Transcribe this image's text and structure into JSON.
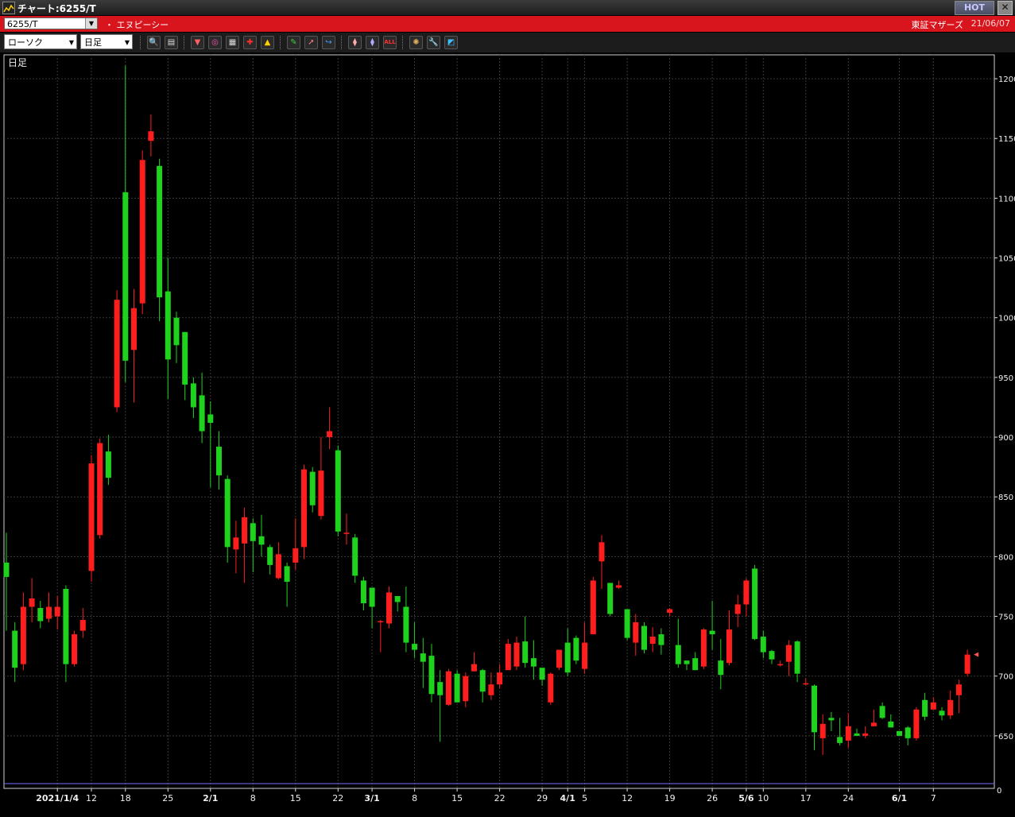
{
  "window": {
    "title": "チャート:6255/T",
    "hot_label": "HOT",
    "close_glyph": "✕"
  },
  "info": {
    "code": "6255/T",
    "company": "・ エヌピーシー",
    "market": "東証マザーズ",
    "date": "21/06/07"
  },
  "toolbar": {
    "chart_type": "ローソク",
    "period": "日足",
    "buttons": [
      {
        "name": "zoom-icon",
        "glyph": "🔍",
        "color": "#3aa0ff"
      },
      {
        "name": "layout-icon",
        "glyph": "▤",
        "color": "#dddddd"
      },
      {
        "name": "insert-icon",
        "glyph": "▼",
        "color": "#ff6060"
      },
      {
        "name": "search-zoom-icon",
        "glyph": "◎",
        "color": "#ff4fb0"
      },
      {
        "name": "table-icon",
        "glyph": "▦",
        "color": "#dddddd"
      },
      {
        "name": "split-icon",
        "glyph": "✚",
        "color": "#ff3030"
      },
      {
        "name": "alert-icon",
        "glyph": "▲",
        "color": "#ffd000"
      },
      {
        "name": "pencil-icon",
        "glyph": "✎",
        "color": "#40d040"
      },
      {
        "name": "pointer-icon",
        "glyph": "➚",
        "color": "#ff8080"
      },
      {
        "name": "redo-icon",
        "glyph": "↪",
        "color": "#40a0ff"
      },
      {
        "name": "candle-left-icon",
        "glyph": "⧫",
        "color": "#ffaaaa"
      },
      {
        "name": "candle-right-icon",
        "glyph": "⧫",
        "color": "#aaaaff"
      },
      {
        "name": "all-icon",
        "glyph": "ALL",
        "color": "#ff3030"
      },
      {
        "name": "settings-icon",
        "glyph": "✺",
        "color": "#e0b060"
      },
      {
        "name": "tool-icon",
        "glyph": "🔧",
        "color": "#ff8040"
      },
      {
        "name": "color-icon",
        "glyph": "◩",
        "color": "#40c0ff"
      }
    ]
  },
  "chart_data": {
    "type": "candlestick",
    "period_label": "日足",
    "y_ticks": [
      650,
      700,
      750,
      800,
      850,
      900,
      950,
      1000,
      1050,
      1100,
      1150,
      1200
    ],
    "y_range": [
      606,
      1220
    ],
    "volume_axis_label": "0",
    "x_labels": [
      {
        "label": "2021/1/4",
        "index": 6,
        "bold": true
      },
      {
        "label": "12",
        "index": 10
      },
      {
        "label": "18",
        "index": 14
      },
      {
        "label": "25",
        "index": 19
      },
      {
        "label": "2/1",
        "index": 24,
        "bold": true
      },
      {
        "label": "8",
        "index": 29
      },
      {
        "label": "15",
        "index": 34
      },
      {
        "label": "22",
        "index": 39
      },
      {
        "label": "3/1",
        "index": 43,
        "bold": true
      },
      {
        "label": "8",
        "index": 48
      },
      {
        "label": "15",
        "index": 53
      },
      {
        "label": "22",
        "index": 58
      },
      {
        "label": "29",
        "index": 63
      },
      {
        "label": "4/1",
        "index": 66,
        "bold": true
      },
      {
        "label": "5",
        "index": 68
      },
      {
        "label": "12",
        "index": 73
      },
      {
        "label": "19",
        "index": 78
      },
      {
        "label": "26",
        "index": 83
      },
      {
        "label": "5/6",
        "index": 87,
        "bold": true
      },
      {
        "label": "10",
        "index": 89
      },
      {
        "label": "17",
        "index": 94
      },
      {
        "label": "24",
        "index": 99
      },
      {
        "label": "6/1",
        "index": 105,
        "bold": true
      },
      {
        "label": "7",
        "index": 109
      }
    ],
    "colors": {
      "up": "#ff1e1e",
      "down": "#1ed21e",
      "grid": "#3a3a3a",
      "axis": "#e0e0e0",
      "text": "#f0f0f0",
      "volume": "#7070ff"
    },
    "candles": [
      [
        795,
        783,
        820,
        738
      ],
      [
        738,
        707,
        745,
        695
      ],
      [
        710,
        758,
        770,
        705
      ],
      [
        758,
        765,
        782,
        745
      ],
      [
        757,
        746,
        763,
        740
      ],
      [
        748,
        758,
        770,
        745
      ],
      [
        750,
        758,
        767,
        739
      ],
      [
        773,
        710,
        776,
        695
      ],
      [
        710,
        735,
        738,
        708
      ],
      [
        738,
        747,
        757,
        732
      ],
      [
        788,
        878,
        885,
        779
      ],
      [
        818,
        895,
        899,
        815
      ],
      [
        888,
        866,
        902,
        860
      ],
      [
        925,
        1015,
        1023,
        921
      ],
      [
        1105,
        964,
        1211,
        946
      ],
      [
        973,
        1008,
        1024,
        929
      ],
      [
        1012,
        1132,
        1140,
        1003
      ],
      [
        1148,
        1156,
        1170,
        1135
      ],
      [
        1127,
        1017,
        1133,
        997
      ],
      [
        1022,
        965,
        1050,
        932
      ],
      [
        1000,
        977,
        1005,
        962
      ],
      [
        988,
        944,
        988,
        931
      ],
      [
        945,
        925,
        950,
        916
      ],
      [
        935,
        905,
        954,
        895
      ],
      [
        919,
        912,
        930,
        858
      ],
      [
        892,
        868,
        905,
        856
      ],
      [
        865,
        808,
        868,
        795
      ],
      [
        806,
        816,
        830,
        786
      ],
      [
        811,
        833,
        841,
        778
      ],
      [
        828,
        813,
        832,
        787
      ],
      [
        817,
        810,
        835,
        800
      ],
      [
        808,
        793,
        810,
        785
      ],
      [
        782,
        802,
        812,
        781
      ],
      [
        792,
        779,
        795,
        758
      ],
      [
        795,
        807,
        832,
        789
      ],
      [
        808,
        873,
        877,
        798
      ],
      [
        871,
        843,
        875,
        837
      ],
      [
        834,
        872,
        900,
        831
      ],
      [
        900,
        905,
        925,
        890
      ],
      [
        889,
        821,
        893,
        817
      ],
      [
        819,
        820,
        836,
        810
      ],
      [
        816,
        784,
        819,
        778
      ],
      [
        780,
        761,
        783,
        755
      ],
      [
        774,
        758,
        774,
        740
      ],
      [
        746,
        746,
        747,
        720
      ],
      [
        744,
        770,
        775,
        740
      ],
      [
        767,
        762,
        767,
        754
      ],
      [
        758,
        728,
        775,
        720
      ],
      [
        727,
        722,
        745,
        715
      ],
      [
        719,
        712,
        732,
        690
      ],
      [
        717,
        685,
        727,
        678
      ],
      [
        695,
        684,
        705,
        645
      ],
      [
        676,
        704,
        706,
        675
      ],
      [
        702,
        678,
        705,
        678
      ],
      [
        679,
        700,
        703,
        674
      ],
      [
        704,
        710,
        720,
        704
      ],
      [
        705,
        687,
        706,
        678
      ],
      [
        684,
        693,
        703,
        680
      ],
      [
        693,
        703,
        710,
        690
      ],
      [
        705,
        727,
        731,
        707
      ],
      [
        708,
        728,
        733,
        705
      ],
      [
        729,
        711,
        750,
        707
      ],
      [
        715,
        708,
        730,
        697
      ],
      [
        707,
        697,
        707,
        692
      ],
      [
        678,
        702,
        703,
        676
      ],
      [
        707,
        722,
        722,
        705
      ],
      [
        728,
        703,
        740,
        700
      ],
      [
        732,
        713,
        734,
        710
      ],
      [
        706,
        728,
        745,
        702
      ],
      [
        735,
        780,
        783,
        735
      ],
      [
        796,
        812,
        818,
        773
      ],
      [
        778,
        752,
        778,
        750
      ],
      [
        774,
        776,
        780,
        773
      ],
      [
        756,
        732,
        756,
        730
      ],
      [
        728,
        745,
        752,
        717
      ],
      [
        742,
        722,
        745,
        719
      ],
      [
        727,
        733,
        741,
        720
      ],
      [
        735,
        726,
        740,
        718
      ],
      [
        753,
        756,
        757,
        750
      ],
      [
        726,
        710,
        748,
        707
      ],
      [
        713,
        710,
        712,
        705
      ],
      [
        715,
        705,
        720,
        705
      ],
      [
        708,
        739,
        740,
        706
      ],
      [
        738,
        735,
        763,
        722
      ],
      [
        713,
        701,
        731,
        689
      ],
      [
        711,
        739,
        755,
        709
      ],
      [
        752,
        760,
        768,
        741
      ],
      [
        760,
        780,
        782,
        750
      ],
      [
        790,
        731,
        793,
        730
      ],
      [
        733,
        720,
        738,
        715
      ],
      [
        721,
        714,
        722,
        710
      ],
      [
        710,
        710,
        713,
        708
      ],
      [
        712,
        726,
        730,
        700
      ],
      [
        729,
        702,
        730,
        695
      ],
      [
        694,
        694,
        698,
        692
      ],
      [
        692,
        653,
        693,
        638
      ],
      [
        648,
        660,
        668,
        634
      ],
      [
        665,
        663,
        670,
        654
      ],
      [
        649,
        644,
        665,
        642
      ],
      [
        646,
        658,
        669,
        640
      ],
      [
        652,
        650,
        656,
        650
      ],
      [
        650,
        652,
        658,
        648
      ],
      [
        658,
        661,
        672,
        658
      ],
      [
        675,
        665,
        678,
        664
      ],
      [
        662,
        657,
        668,
        657
      ],
      [
        654,
        650,
        654,
        650
      ],
      [
        657,
        648,
        658,
        642
      ],
      [
        648,
        672,
        674,
        646
      ],
      [
        680,
        666,
        686,
        663
      ],
      [
        672,
        678,
        682,
        678
      ],
      [
        671,
        667,
        674,
        663
      ],
      [
        667,
        680,
        688,
        664
      ],
      [
        684,
        693,
        697,
        669
      ],
      [
        702,
        718,
        722,
        700
      ]
    ]
  }
}
